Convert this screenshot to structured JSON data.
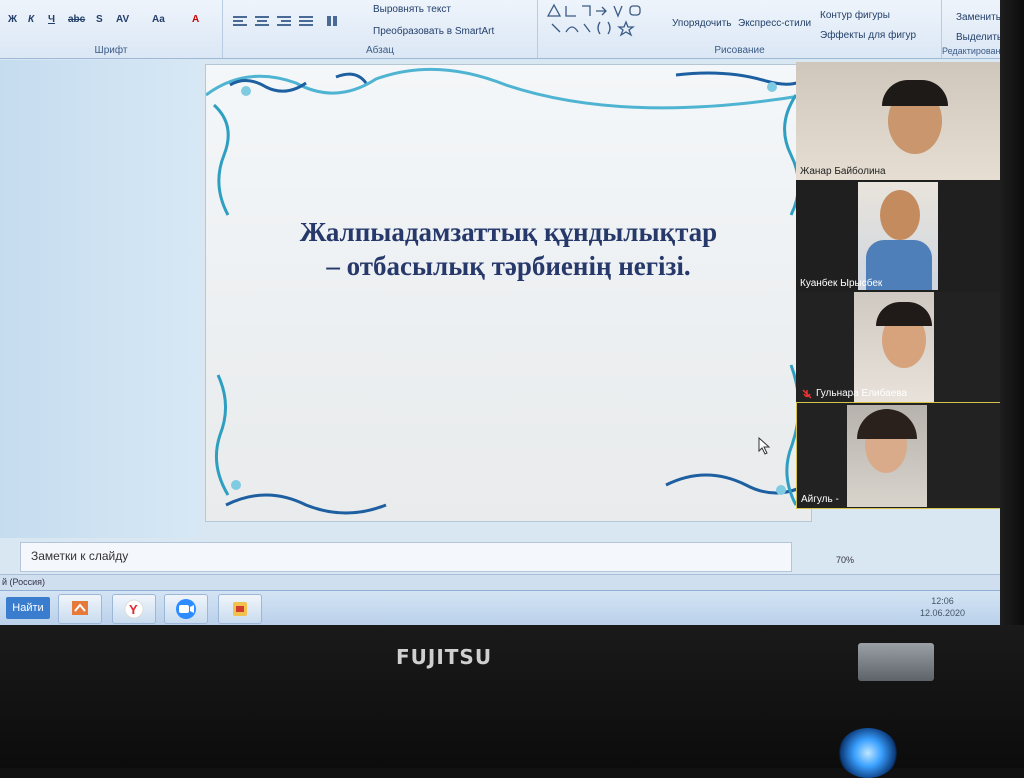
{
  "ribbon": {
    "font_group": "Шрифт",
    "paragraph_group": "Абзац",
    "drawing_group": "Рисование",
    "editing_group": "Редактирование",
    "align_text": "Выровнять текст",
    "convert_smartart": "Преобразовать в SmartArt",
    "arrange": "Упорядочить",
    "quick_styles": "Экспресс-стили",
    "shape_outline": "Контур фигуры",
    "shape_effects": "Эффекты для фигур",
    "replace": "Заменить",
    "select": "Выделить",
    "font_buttons": [
      "Ж",
      "К",
      "Ч",
      "abc",
      "S",
      "AV",
      "Aa",
      "A"
    ]
  },
  "slide": {
    "title_line1": "Жалпыадамзаттық құндылықтар",
    "title_line2": "– отбасылық тәрбиенің негізі."
  },
  "notes": {
    "placeholder": "Заметки к слайду"
  },
  "status": {
    "language": "й (Россия)",
    "zoom": "70%"
  },
  "taskbar": {
    "find_label": "Найти",
    "clock_time": "12:06",
    "clock_date": "12.06.2020"
  },
  "participants": [
    {
      "name": "Жанар Байболина"
    },
    {
      "name": "Куанбек Ырысбек"
    },
    {
      "name": "Гульнара Елибаева"
    },
    {
      "name": "Айгуль -"
    }
  ],
  "monitor": {
    "brand": "FUJITSU"
  },
  "colors": {
    "title": "#27396b",
    "ornament": "#2e9fc0",
    "taskbar_find": "#3a7dcf"
  }
}
